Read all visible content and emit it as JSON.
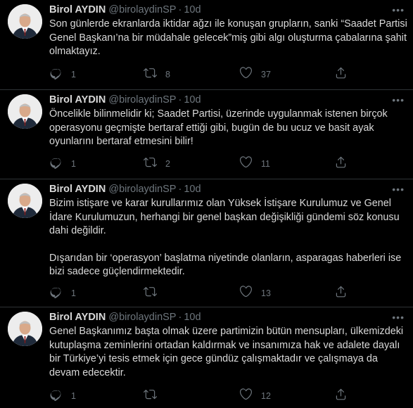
{
  "tweets": [
    {
      "name": "Birol AYDIN",
      "handle": "@birolaydinSP",
      "separator": "·",
      "time": "10d",
      "paragraphs": [
        "Son günlerde ekranlarda iktidar ağzı ile konuşan grupların, sanki “Saadet Partisi Genel Başkanı’na bir müdahale gelecek”miş gibi algı oluşturma çabalarına şahit olmaktayız."
      ],
      "replies": "1",
      "retweets": "8",
      "likes": "37"
    },
    {
      "name": "Birol AYDIN",
      "handle": "@birolaydinSP",
      "separator": "·",
      "time": "10d",
      "paragraphs": [
        "Öncelikle bilinmelidir ki; Saadet Partisi, üzerinde uygulanmak istenen birçok operasyonu geçmişte bertaraf ettiği gibi, bugün de bu ucuz ve basit ayak oyunlarını bertaraf etmesini bilir!"
      ],
      "replies": "1",
      "retweets": "2",
      "likes": "11"
    },
    {
      "name": "Birol AYDIN",
      "handle": "@birolaydinSP",
      "separator": "·",
      "time": "10d",
      "paragraphs": [
        "Bizim istişare ve karar kurullarımız olan Yüksek İstişare Kurulumuz ve Genel İdare Kurulumuzun, herhangi bir genel başkan değişikliği gündemi söz konusu dahi değildir.",
        "Dışarıdan bir ‘operasyon’ başlatma niyetinde olanların, asparagas haberleri ise bizi sadece güçlendirmektedir."
      ],
      "replies": "1",
      "retweets": "",
      "likes": "13"
    },
    {
      "name": "Birol AYDIN",
      "handle": "@birolaydinSP",
      "separator": "·",
      "time": "10d",
      "paragraphs": [
        "Genel Başkanımız başta olmak üzere partimizin bütün mensupları, ülkemizdeki kutuplaşma zeminlerini ortadan kaldırmak ve insanımıza hak ve adalete dayalı bir Türkiye’yi tesis etmek için gece gündüz çalışmaktadır ve çalışmaya da devam edecektir."
      ],
      "replies": "1",
      "retweets": "",
      "likes": "12"
    }
  ],
  "icons": {
    "reply": "reply-icon",
    "retweet": "retweet-icon",
    "like": "like-icon",
    "share": "share-icon",
    "more": "more-icon"
  },
  "colors": {
    "background": "#000000",
    "text": "#d9d9d9",
    "secondary": "#6e767d",
    "divider": "#2f3336"
  }
}
